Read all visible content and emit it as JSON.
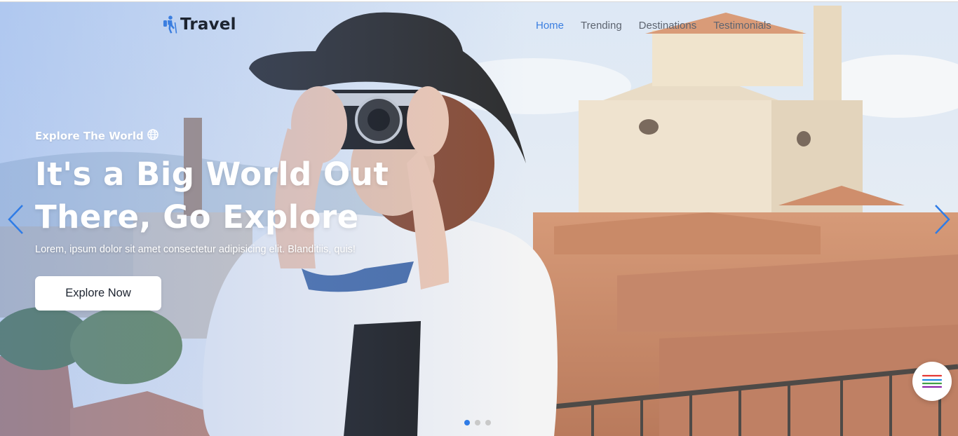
{
  "brand": {
    "name": "Travel",
    "icon": "hiker-icon",
    "icon_color": "#3b7ee0"
  },
  "nav": {
    "items": [
      {
        "label": "Home",
        "active": true
      },
      {
        "label": "Trending",
        "active": false
      },
      {
        "label": "Destinations",
        "active": false
      },
      {
        "label": "Testimonials",
        "active": false
      }
    ]
  },
  "hero": {
    "eyebrow": "Explore The World",
    "eyebrow_icon": "globe-icon",
    "headline_line1": "It's a Big World Out",
    "headline_line2": "There, Go Explore",
    "subtext": "Lorem, ipsum dolor sit amet consectetur adipisicing elit. Blanditiis, quis!",
    "cta_label": "Explore Now"
  },
  "slider": {
    "prev_icon": "chevron-left-icon",
    "next_icon": "chevron-right-icon",
    "slide_count": 3,
    "active_slide": 1
  },
  "menu_button": {
    "icon": "hamburger-menu-icon"
  },
  "colors": {
    "accent": "#3b7ee0",
    "text_dark": "#1d2430",
    "nav_text": "#5d6470",
    "menu_lines": [
      "#e53935",
      "#1e88e5",
      "#43a047",
      "#8e24aa"
    ]
  }
}
